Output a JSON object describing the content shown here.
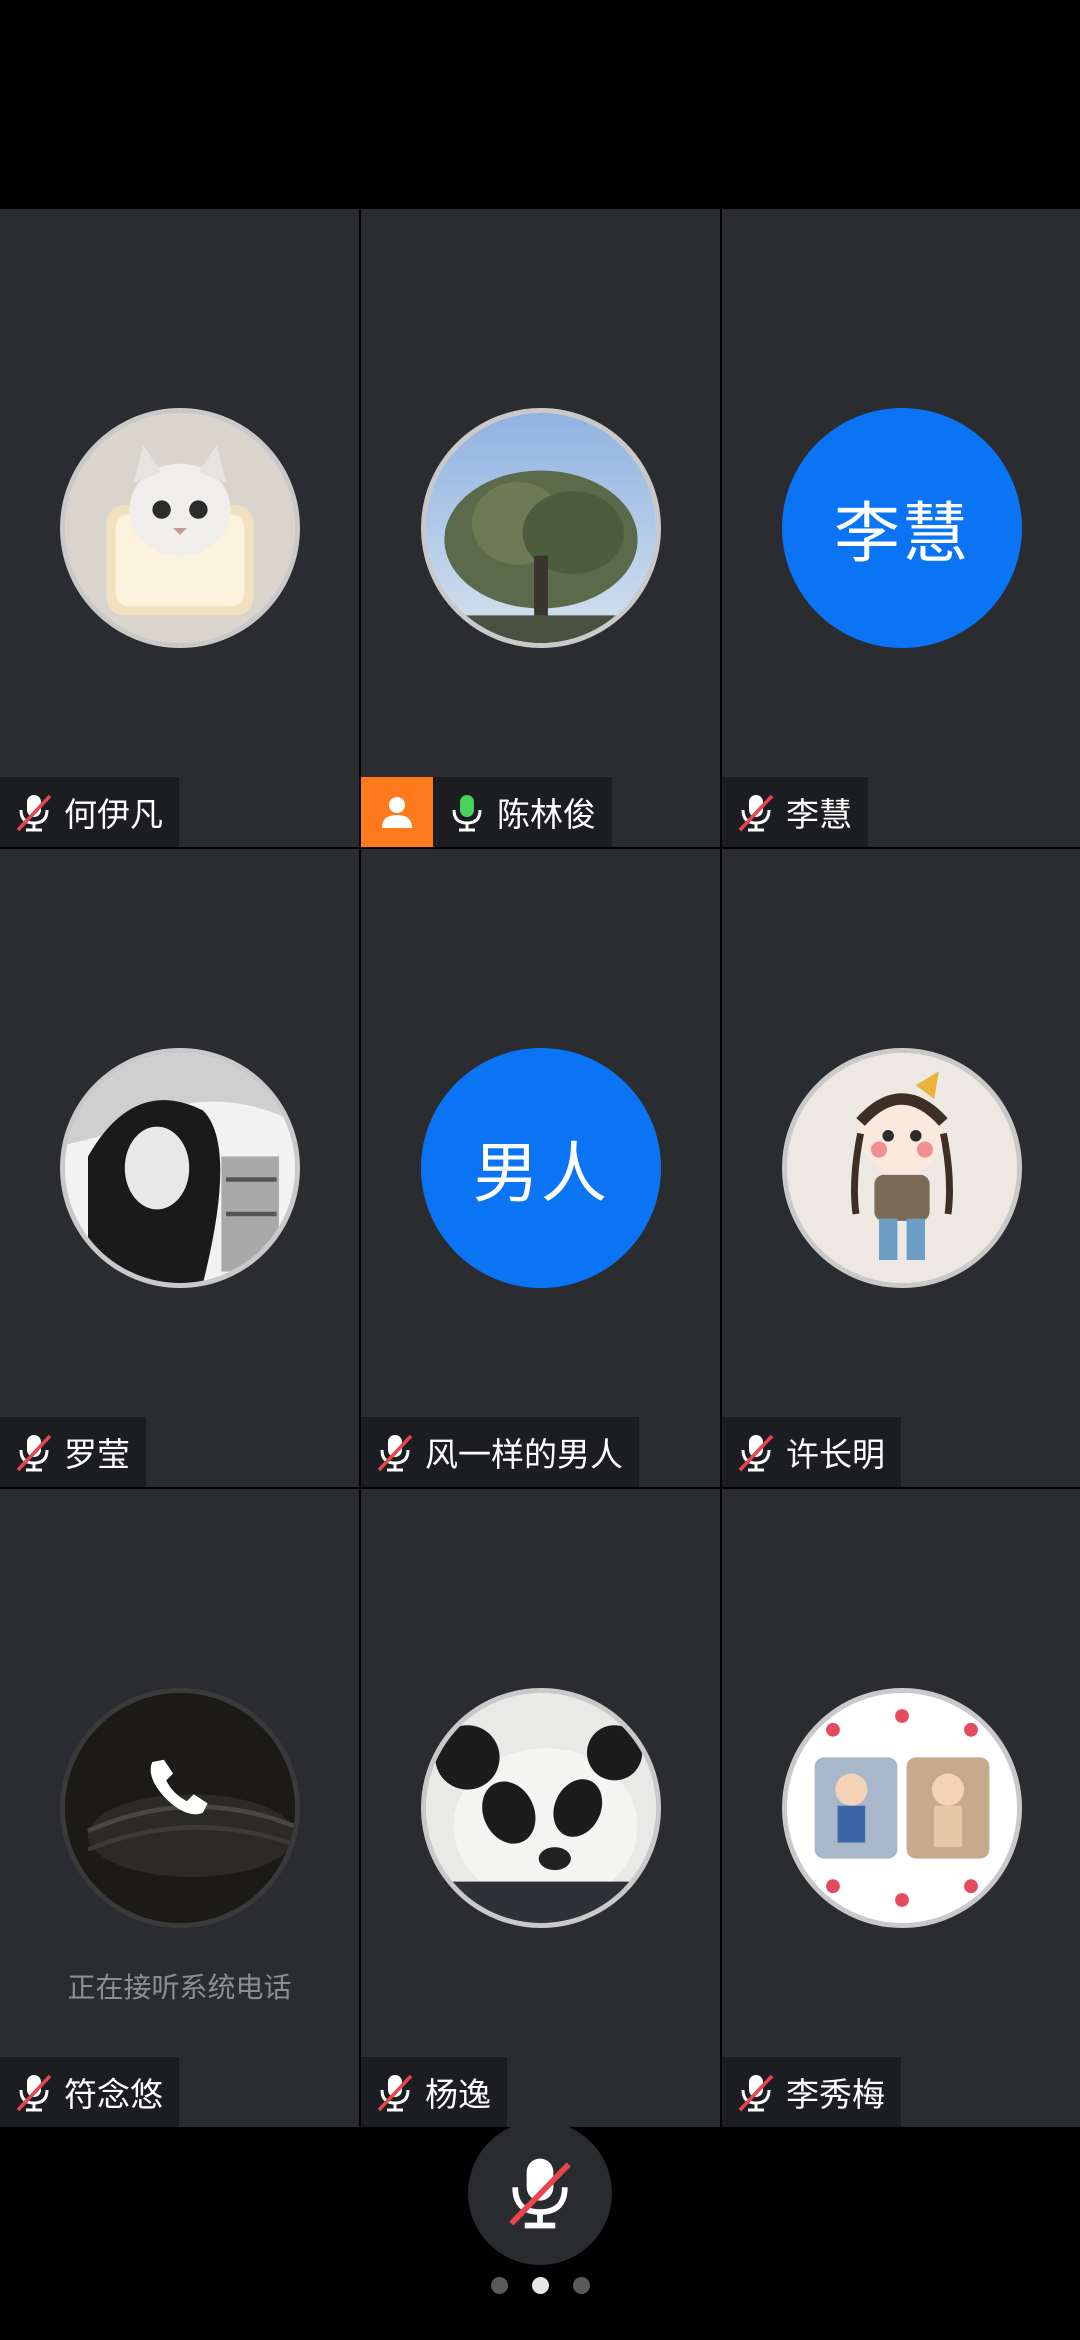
{
  "participants": [
    {
      "name": "何伊凡",
      "avatar": "cat-photo",
      "mic": "muted"
    },
    {
      "name": "陈林俊",
      "avatar": "tree-photo",
      "mic": "on",
      "host": true
    },
    {
      "name": "李慧",
      "avatar_text": "李慧",
      "mic": "muted"
    },
    {
      "name": "罗莹",
      "avatar": "woman-sketch-photo",
      "mic": "muted"
    },
    {
      "name": "风一样的男人",
      "avatar_text": "男人",
      "mic": "muted"
    },
    {
      "name": "许长明",
      "avatar": "cartoon-girl",
      "mic": "muted"
    },
    {
      "name": "符念悠",
      "avatar": "stadium-night-photo",
      "mic": "muted",
      "status": "正在接听系统电话"
    },
    {
      "name": "杨逸",
      "avatar": "panda-photo",
      "mic": "muted"
    },
    {
      "name": "李秀梅",
      "avatar": "kids-spring-photo",
      "mic": "muted"
    }
  ],
  "controls": {
    "mic_button_icon": "mic-muted-icon",
    "pages": 3,
    "active_page": 2
  },
  "colors": {
    "tile_bg": "#2a2c30",
    "text_avatar_bg": "#0a74f5",
    "host_badge": "#ff7a1c",
    "mute_slash": "#e8454f"
  }
}
